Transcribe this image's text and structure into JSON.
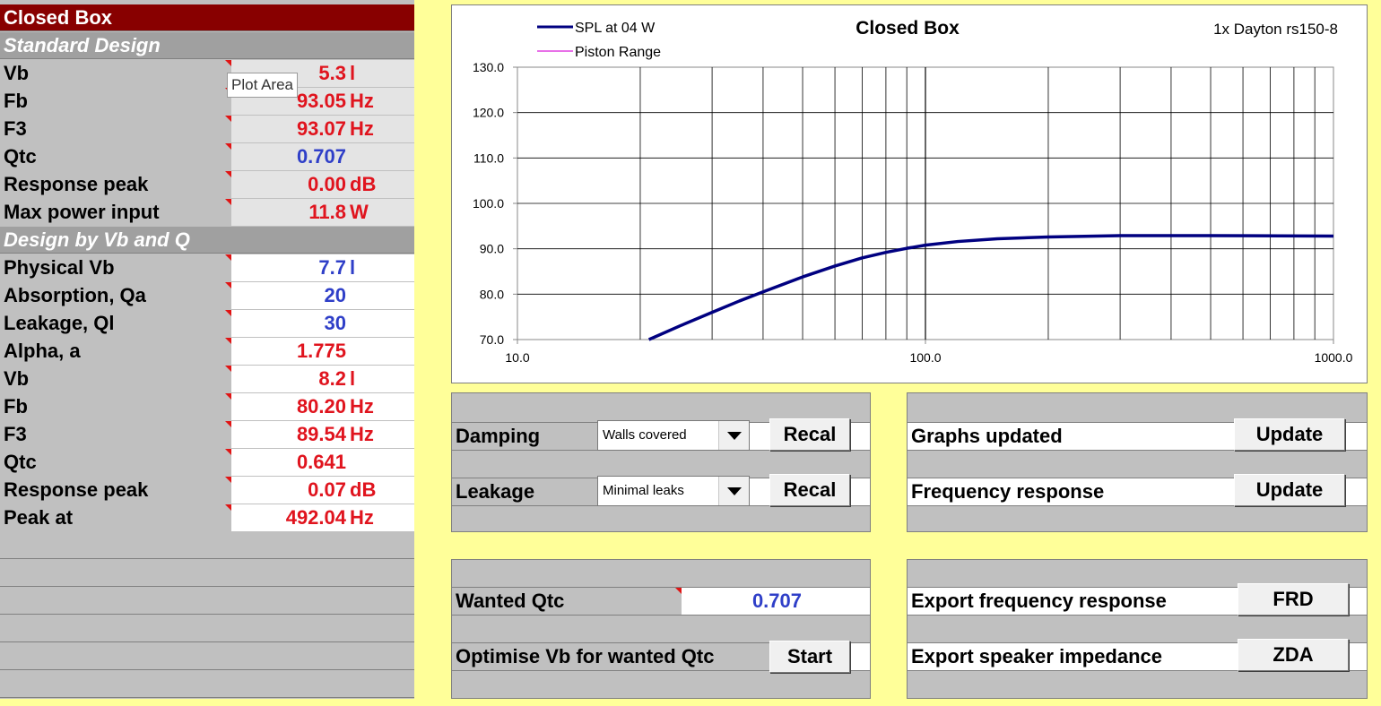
{
  "left": {
    "title": "Closed Box",
    "standard_section": "Standard Design",
    "standard_rows": [
      {
        "label": "Vb",
        "value": "5.3",
        "unit": "l",
        "color": "red"
      },
      {
        "label": "Fb",
        "value": "93.05",
        "unit": "Hz",
        "color": "red"
      },
      {
        "label": "F3",
        "value": "93.07",
        "unit": "Hz",
        "color": "red"
      },
      {
        "label": "Qtc",
        "value": "0.707",
        "unit": "",
        "color": "blue"
      },
      {
        "label": "Response peak",
        "value": "0.00",
        "unit": "dB",
        "color": "red"
      },
      {
        "label": "Max power input",
        "value": "11.8",
        "unit": "W",
        "color": "red"
      }
    ],
    "design_section": "Design by Vb and Q",
    "design_rows": [
      {
        "label": "Physical Vb",
        "value": "7.7",
        "unit": "l",
        "color": "blue"
      },
      {
        "label": "Absorption, Qa",
        "value": "20",
        "unit": "",
        "color": "blue"
      },
      {
        "label": "Leakage, Ql",
        "value": "30",
        "unit": "",
        "color": "blue"
      },
      {
        "label": "Alpha, a",
        "value": "1.775",
        "unit": "",
        "color": "red"
      },
      {
        "label": "Vb",
        "value": "8.2",
        "unit": "l",
        "color": "red"
      },
      {
        "label": "Fb",
        "value": "80.20",
        "unit": "Hz",
        "color": "red"
      },
      {
        "label": "F3",
        "value": "89.54",
        "unit": "Hz",
        "color": "red"
      },
      {
        "label": "Qtc",
        "value": "0.641",
        "unit": "",
        "color": "red"
      },
      {
        "label": "Response peak",
        "value": "0.07",
        "unit": "dB",
        "color": "red"
      },
      {
        "label": "Peak at",
        "value": "492.04",
        "unit": "Hz",
        "color": "red"
      }
    ]
  },
  "tooltip": "Plot Area",
  "chart": {
    "title": "Closed Box",
    "subtitle": "1x Dayton rs150-8",
    "legend": [
      "SPL at 04 W",
      "Piston Range"
    ]
  },
  "chart_data": {
    "type": "line",
    "title": "Closed Box",
    "subtitle": "1x Dayton rs150-8",
    "x_scale": "log",
    "xlim": [
      10,
      1000
    ],
    "ylim": [
      70,
      130
    ],
    "x_ticks": [
      "10.0",
      "100.0",
      "1000.0"
    ],
    "y_ticks": [
      "130.0",
      "120.0",
      "110.0",
      "100.0",
      "90.0",
      "80.0",
      "70.0"
    ],
    "legend_position": "top-left",
    "grid": true,
    "series": [
      {
        "name": "SPL at 04 W",
        "color": "#000080",
        "x": [
          21,
          25,
          30,
          35,
          40,
          50,
          60,
          70,
          80,
          90,
          100,
          120,
          150,
          200,
          300,
          500,
          1000
        ],
        "y": [
          70.0,
          73.0,
          76.0,
          78.5,
          80.5,
          83.8,
          86.2,
          88.0,
          89.2,
          90.1,
          90.8,
          91.6,
          92.2,
          92.6,
          92.9,
          92.9,
          92.8
        ]
      },
      {
        "name": "Piston Range",
        "color": "#e040e0",
        "x": [],
        "y": []
      }
    ]
  },
  "controls": {
    "damping_label": "Damping",
    "damping_value": "Walls covered",
    "leakage_label": "Leakage",
    "leakage_value": "Minimal leaks",
    "recal_label": "Recal",
    "graphs_updated_label": "Graphs updated",
    "freq_response_label": "Frequency response",
    "update_label": "Update",
    "wanted_qtc_label": "Wanted Qtc",
    "wanted_qtc_value": "0.707",
    "optimise_label": "Optimise Vb for wanted Qtc",
    "start_label": "Start",
    "export_freq_label": "Export frequency response",
    "frd_label": "FRD",
    "export_imp_label": "Export speaker impedance",
    "zda_label": "ZDA"
  }
}
